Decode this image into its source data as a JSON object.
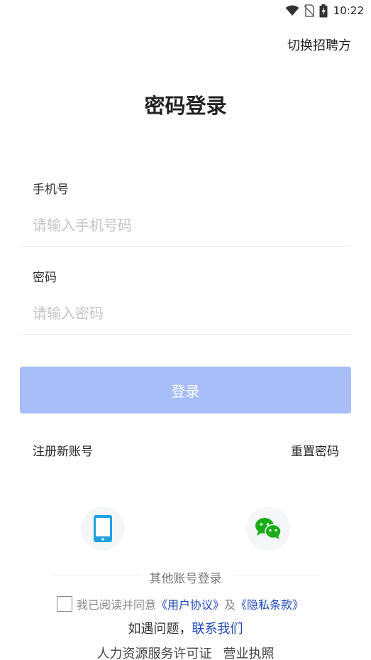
{
  "status_bar": {
    "time": "10:22",
    "icons": [
      "wifi-icon",
      "no-sim-icon",
      "battery-charging-icon"
    ]
  },
  "header": {
    "switch_role": "切换招聘方",
    "title": "密码登录"
  },
  "form": {
    "phone": {
      "label": "手机号",
      "placeholder": "请输入手机号码",
      "value": ""
    },
    "password": {
      "label": "密码",
      "placeholder": "请输入密码",
      "value": ""
    },
    "submit_label": "登录",
    "submit_color": "#a7bdf7"
  },
  "links": {
    "register": "注册新账号",
    "reset_password": "重置密码"
  },
  "alt_login": {
    "methods": [
      {
        "icon": "phone-icon",
        "color": "#1fa2e1"
      },
      {
        "icon": "wechat-icon",
        "color": "#1aad19"
      }
    ],
    "label": "其他账号登录"
  },
  "agreement": {
    "checked": false,
    "prefix": "我已阅读并同意",
    "user_agreement": "《用户协议》",
    "and": "及",
    "privacy_policy": "《隐私条款》",
    "link_color": "#1c47b8"
  },
  "help": {
    "prefix": "如遇问题，",
    "contact": "联系我们"
  },
  "footer": {
    "license": "人力资源服务许可证",
    "business_license": "营业执照"
  }
}
